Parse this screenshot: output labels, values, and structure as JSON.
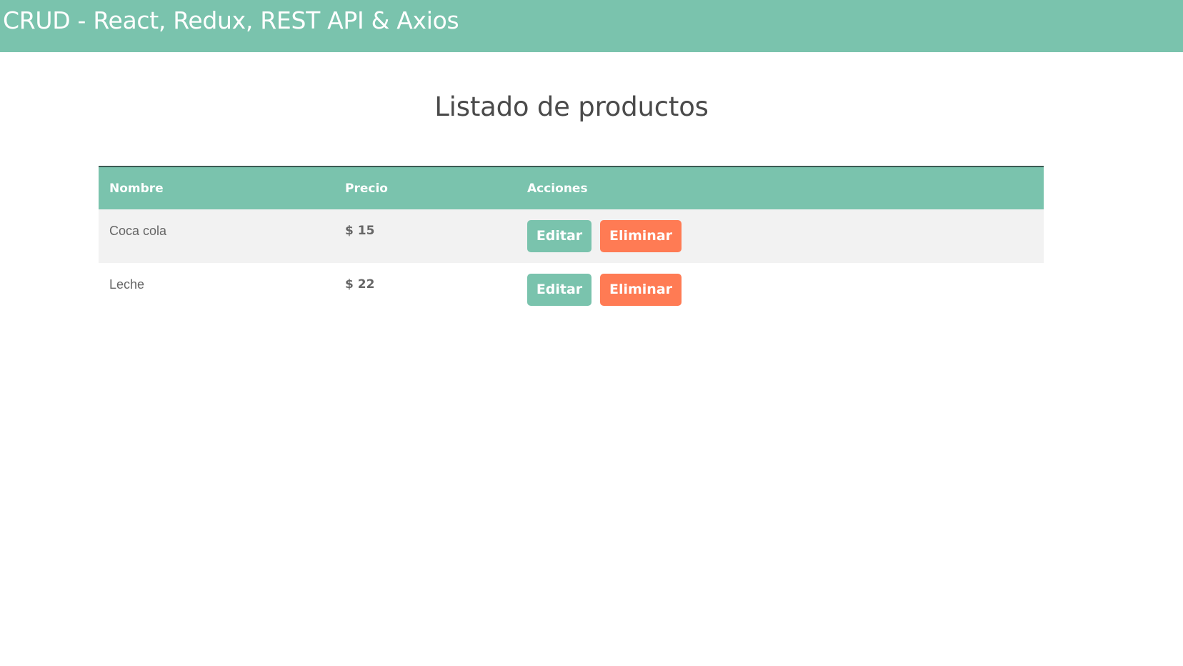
{
  "header": {
    "title": "CRUD - React, Redux, REST API & Axios"
  },
  "main": {
    "title": "Listado de productos",
    "table": {
      "columns": [
        "Nombre",
        "Precio",
        "Acciones"
      ],
      "rows": [
        {
          "nombre": "Coca cola",
          "precio": "$ 15",
          "edit_label": "Editar",
          "delete_label": "Eliminar"
        },
        {
          "nombre": "Leche",
          "precio": "$ 22",
          "edit_label": "Editar",
          "delete_label": "Eliminar"
        }
      ]
    }
  },
  "colors": {
    "accent": "#7ac3ad",
    "danger": "#ff7b54",
    "row_alt": "#f2f2f2"
  }
}
